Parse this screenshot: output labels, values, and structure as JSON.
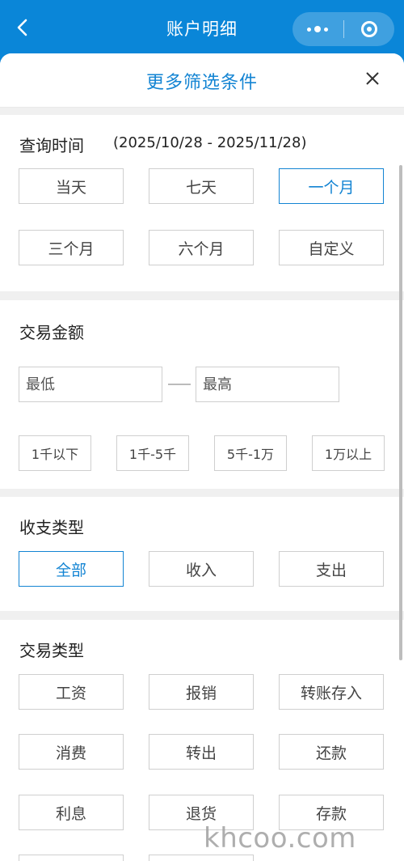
{
  "header": {
    "title": "账户明细",
    "back_icon": "chevron-left-icon",
    "more_icon": "more-dots-icon",
    "close_app_icon": "target-circle-icon",
    "accent_color": "#0a86d8"
  },
  "sheet": {
    "title": "更多筛选条件",
    "close_icon": "close-icon",
    "title_color": "#1384d3"
  },
  "time": {
    "label": "查询时间",
    "range": "(2025/10/28 - 2025/11/28)",
    "options": [
      "当天",
      "七天",
      "一个月",
      "三个月",
      "六个月",
      "自定义"
    ],
    "selected": "一个月"
  },
  "amount": {
    "label": "交易金额",
    "min_placeholder": "最低",
    "max_placeholder": "最高",
    "min_value": "",
    "max_value": "",
    "quick_options": [
      "1千以下",
      "1千-5千",
      "5千-1万",
      "1万以上"
    ]
  },
  "income_type": {
    "label": "收支类型",
    "options": [
      "全部",
      "收入",
      "支出"
    ],
    "selected": "全部"
  },
  "trade_type": {
    "label": "交易类型",
    "options": [
      "工资",
      "报销",
      "转账存入",
      "消费",
      "转出",
      "还款",
      "利息",
      "退货",
      "存款"
    ]
  },
  "watermark": "khcoo.com"
}
